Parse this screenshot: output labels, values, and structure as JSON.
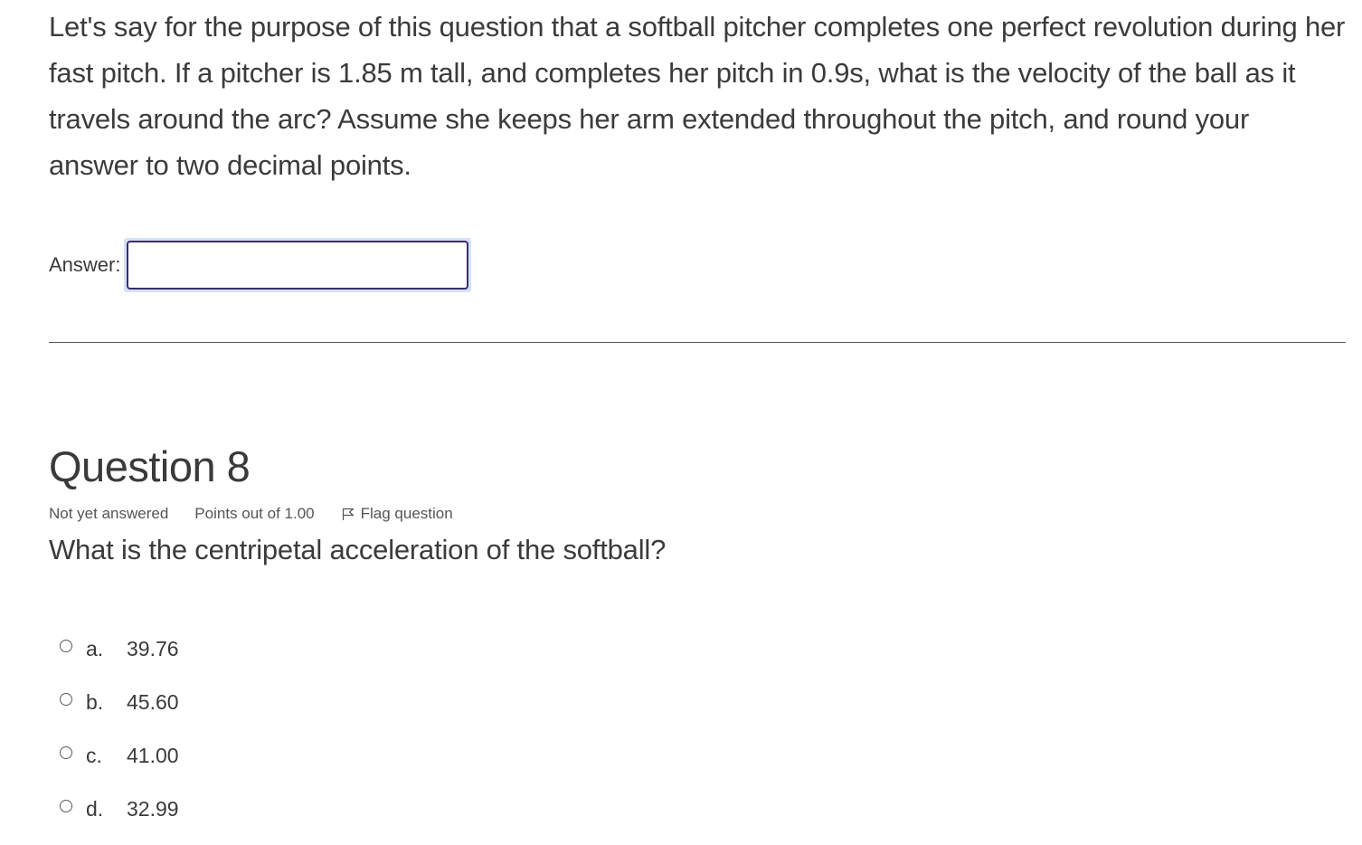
{
  "previous_question": {
    "text": "Let's say for the purpose of this question that a softball pitcher completes one perfect revolution during her fast pitch. If a pitcher is 1.85 m tall, and completes her pitch in 0.9s, what is the velocity of the ball as it travels around the arc? Assume she keeps her arm extended throughout the pitch, and round your answer to two decimal points.",
    "answer_label": "Answer:",
    "answer_value": ""
  },
  "question": {
    "heading": "Question 8",
    "status": "Not yet answered",
    "points": "Points out of 1.00",
    "flag_label": "Flag question",
    "flag_icon": "flag-icon",
    "text": "What is the centripetal acceleration of the softball?",
    "options": [
      {
        "letter": "a.",
        "value": "39.76"
      },
      {
        "letter": "b.",
        "value": "45.60"
      },
      {
        "letter": "c.",
        "value": "41.00"
      },
      {
        "letter": "d.",
        "value": "32.99"
      }
    ]
  },
  "colors": {
    "text": "#3b3b3b",
    "input_border": "#3a2b78",
    "focus_ring": "#d4e2f5"
  }
}
